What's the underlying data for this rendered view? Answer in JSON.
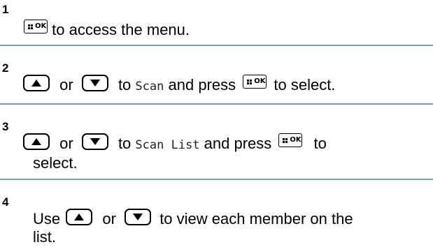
{
  "steps": [
    {
      "number": "1",
      "line1": "to access the menu."
    },
    {
      "number": "2",
      "or": "or",
      "to": "to",
      "menu_item": "Scan",
      "and_press": "and press",
      "to_select": "to select."
    },
    {
      "number": "3",
      "or": "or",
      "to": "to",
      "menu_item": "Scan List",
      "and_press": "and press",
      "to_word": "to",
      "line2": "select."
    },
    {
      "number": "4",
      "use": "Use",
      "or": "or",
      "rest": "to view each member on the",
      "line2": "list."
    }
  ],
  "buttons": {
    "ok_label": "OK",
    "ok_icon": "menu-ok-key-icon",
    "up_icon": "up-arrow-key-icon",
    "down_icon": "down-arrow-key-icon"
  },
  "colors": {
    "separator": "#7f9cb6"
  }
}
